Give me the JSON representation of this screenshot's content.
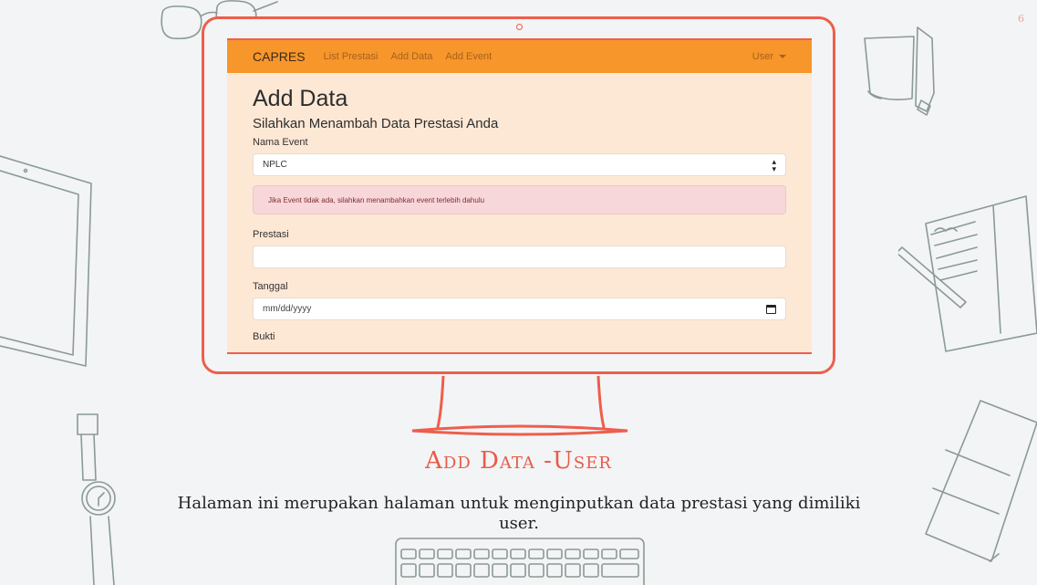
{
  "slide": {
    "page_number": "6"
  },
  "navbar": {
    "brand": "CAPRES",
    "links": [
      "List Prestasi",
      "Add Data",
      "Add Event"
    ],
    "user_label": "User"
  },
  "form": {
    "title": "Add Data",
    "subtitle": "Silahkan Menambah Data Prestasi Anda",
    "event_label": "Nama Event",
    "event_value": "NPLC",
    "alert_text": "Jika Event tidak ada, silahkan menambahkan event terlebih dahulu",
    "prestasi_label": "Prestasi",
    "prestasi_value": "",
    "tanggal_label": "Tanggal",
    "tanggal_placeholder": "mm/dd/yyyy",
    "bukti_label": "Bukti"
  },
  "caption": {
    "title": "Add Data -User",
    "text": "Halaman ini merupakan halaman untuk menginputkan data prestasi yang dimiliki user."
  },
  "colors": {
    "accent": "#ee5e4d",
    "navbar": "#f6962b",
    "screen_bg": "#fde8d5",
    "alert_bg": "#f8d7da"
  }
}
